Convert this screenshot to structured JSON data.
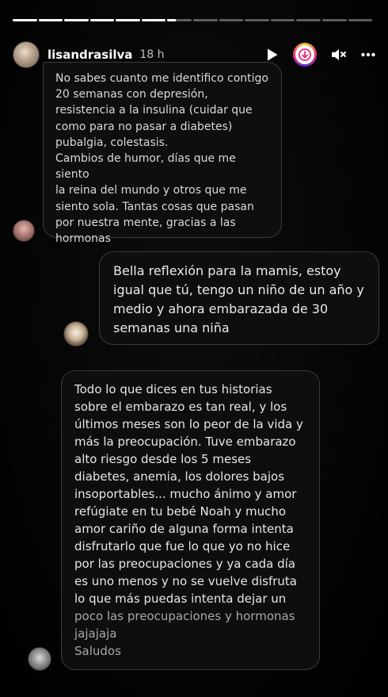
{
  "story": {
    "segments_total": 14,
    "segments_completed": 6,
    "current_segment_progress": 0.35
  },
  "header": {
    "username": "lisandrasilva",
    "time": "18 h",
    "icons": [
      "play-icon",
      "boost-icon",
      "mute-icon",
      "more-icon"
    ]
  },
  "messages": [
    {
      "lines": [
        "No sabes cuanto me identifico contigo",
        "20 semanas con depresión,",
        "resistencia a la insulina (cuidar que",
        "como para no pasar a diabetes)",
        "pubalgia, colestasis.",
        "Cambios de humor, días que me siento",
        "la reina del mundo y otros que me",
        "siento sola. Tantas cosas que pasan",
        "por nuestra mente, gracias a las",
        "hormonas"
      ]
    },
    {
      "lines": [
        "Bella reflexión para la mamis, estoy",
        "igual que tú, tengo un niño de un año y",
        "medio y ahora embarazada de 30",
        "semanas una niña"
      ]
    },
    {
      "lines": [
        "Todo lo que dices en tus historias",
        "sobre el embarazo es tan real, y los",
        "últimos meses son lo peor de la vida y",
        "más la preocupación. Tuve embarazo",
        "alto riesgo desde los 5 meses",
        "diabetes, anemia, los dolores bajos",
        "insoportables... mucho ánimo y amor",
        "refúgiate en tu bebé Noah y mucho",
        "amor cariño  de alguna forma intenta",
        "disfrutarlo que fue lo que yo no hice",
        "por las preocupaciones y ya cada día",
        "es uno menos y no se vuelve disfruta",
        "lo que más puedas intenta dejar un",
        "poco las preocupaciones y hormonas",
        "jajajaja",
        "Saludos"
      ]
    }
  ],
  "colors": {
    "background": "#000000",
    "bubble_bg": "#0e0e0e",
    "bubble_border": "#3b3b3b",
    "boost_gradient": [
      "#f9ce34",
      "#ee2a7b",
      "#6228d7"
    ]
  }
}
